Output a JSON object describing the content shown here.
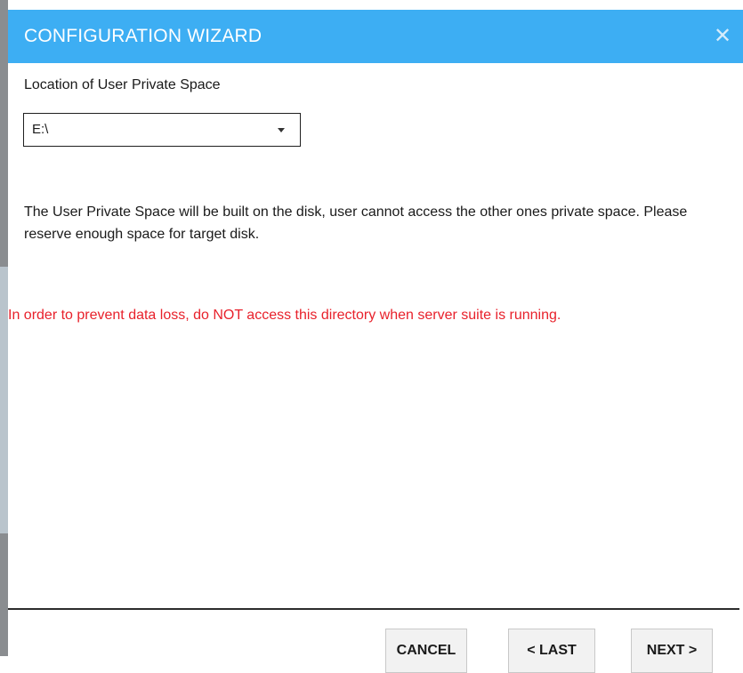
{
  "window": {
    "title": "CONFIGURATION WIZARD",
    "close_symbol": "✕",
    "close_icon": "close-icon"
  },
  "location": {
    "label": "Location of User Private Space",
    "selected_value": "E:\\",
    "dropdown_icon": "chevron-down-icon"
  },
  "info": {
    "description": "The User Private Space will be built on the disk, user cannot access the other ones private space. Please reserve enough space for target disk.",
    "warning": "In order to prevent data loss, do NOT access this directory when server suite is running."
  },
  "footer": {
    "cancel_label": "CANCEL",
    "last_label": "< LAST",
    "next_label": "NEXT >"
  },
  "colors": {
    "title_bar": "#3daef3",
    "warning_text": "#e8212b",
    "button_bg": "#f2f2f2"
  }
}
